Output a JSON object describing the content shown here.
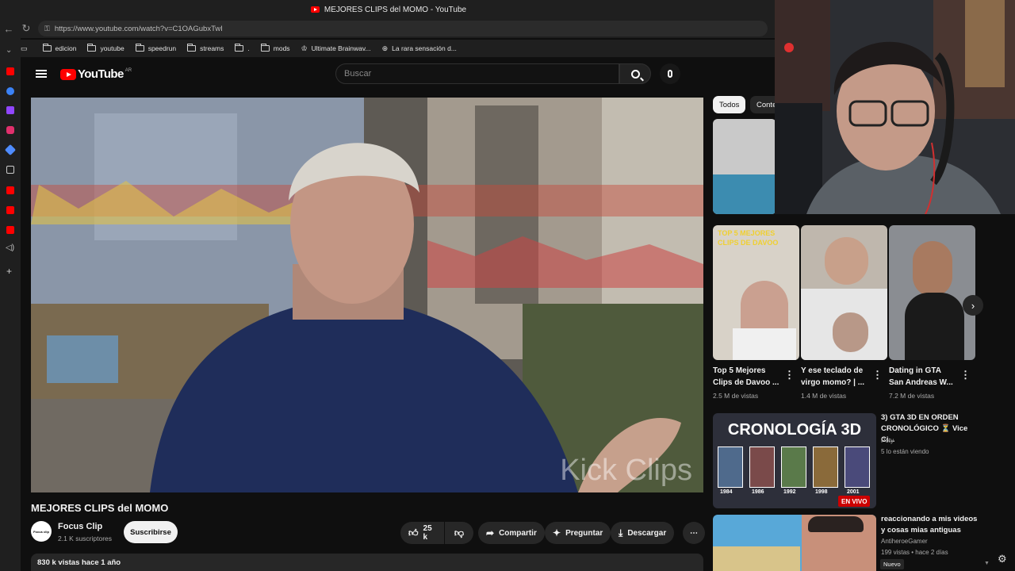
{
  "browser": {
    "tab_title": "MEJORES CLIPS del MOMO - YouTube",
    "url": "https://www.youtube.com/watch?v=C1OAGubxTwI",
    "bookmarks": [
      "edicion",
      "youtube",
      "speedrun",
      "streams",
      ".",
      "mods",
      "Ultimate Brainwav...",
      "La rara sensación d..."
    ]
  },
  "youtube": {
    "logo_text": "YouTube",
    "country_code": "AR",
    "search_placeholder": "Buscar"
  },
  "video": {
    "watermark": "Kick Clips",
    "title": "MEJORES CLIPS del MOMO",
    "channel": "Focus Clip",
    "channel_avatar_text": "Focus clip",
    "subscribers": "2.1 K suscriptores",
    "subscribe_label": "Suscribirse",
    "likes": "25 k",
    "share_label": "Compartir",
    "ask_label": "Preguntar",
    "download_label": "Descargar",
    "views_date": "830 k vistas  hace 1 año"
  },
  "chips": [
    "Todos",
    "Conte"
  ],
  "shorts": [
    {
      "title": "Top 5 Mejores Clips de Davoo ...",
      "views": "2.5 M de vistas",
      "thumb_text": "TOP 5 MEJORES CLIPS DE DAVOO"
    },
    {
      "title": "Y ese teclado de virgo momo? | ...",
      "views": "1.4 M de vistas"
    },
    {
      "title": "Dating in GTA San Andreas W...",
      "views": "7.2 M de vistas"
    }
  ],
  "related": [
    {
      "title": "3) GTA 3D EN ORDEN CRONOLÓGICO ⏳ Vice Ci...",
      "channel": "Poty",
      "meta": "5 lo están viendo",
      "badge": "EN VIVO",
      "thumb_text": "CRONOLOGÍA 3D",
      "years": [
        "1984",
        "1986",
        "1992",
        "1998",
        "2001"
      ]
    },
    {
      "title": "reaccionando a mis videos y cosas mias antiguas",
      "channel": "AntiheroeGamer",
      "meta": "199 vistas • hace 2 días",
      "badge": "Nuevo"
    }
  ]
}
